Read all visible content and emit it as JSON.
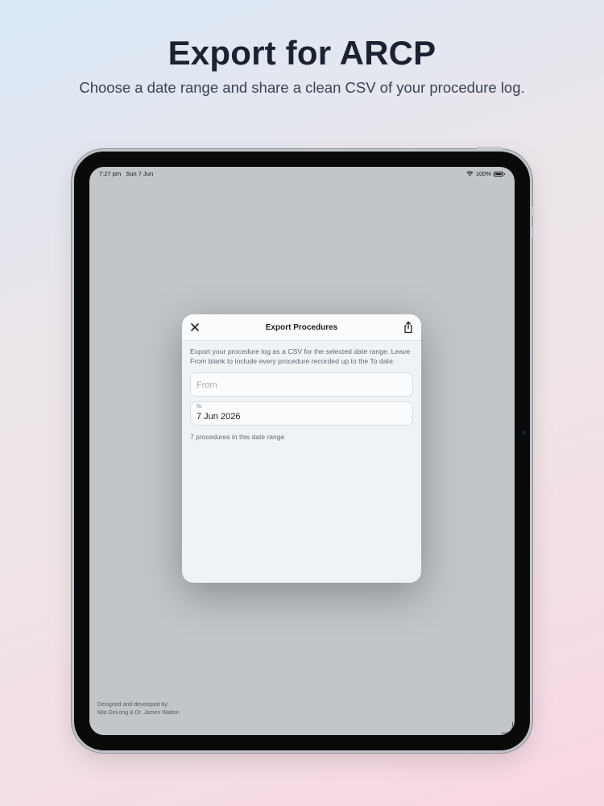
{
  "promo": {
    "headline": "Export for ARCP",
    "subheadline": "Choose a date range and share a clean CSV of your procedure log."
  },
  "status_bar": {
    "time": "7:27 pm",
    "date": "Sun 7 Jun",
    "battery": "100%"
  },
  "modal": {
    "title": "Export Procedures",
    "description": "Export your procedure log as a CSV for the selected date range. Leave From blank to include every procedure recorded up to the To date.",
    "from_placeholder": "From",
    "to_label": "To",
    "to_value": "7 Jun 2026",
    "count_text": "7 procedures in this date range"
  },
  "credits": {
    "line1": "Designed and developed by:",
    "line2": "Mat DeLong & Dr. James Walton"
  },
  "icons": {
    "close": "close-icon",
    "share": "share-icon",
    "wifi": "wifi-icon",
    "battery": "battery-icon"
  }
}
